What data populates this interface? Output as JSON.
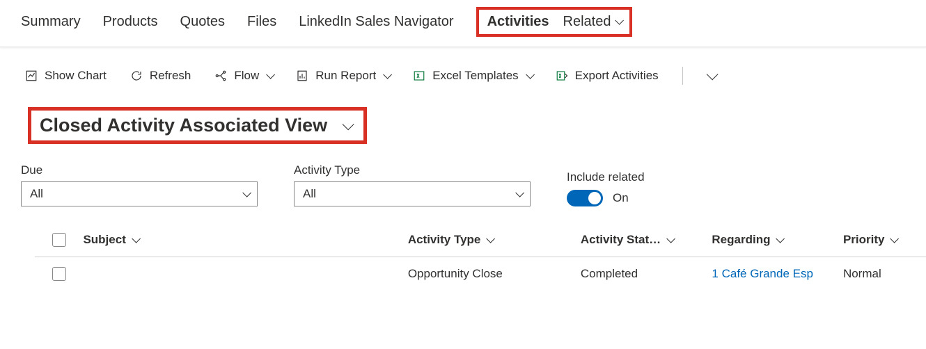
{
  "tabs": {
    "t0": "Summary",
    "t1": "Products",
    "t2": "Quotes",
    "t3": "Files",
    "t4": "LinkedIn Sales Navigator",
    "t5": "Activities",
    "t6": "Related"
  },
  "toolbar": {
    "show_chart": "Show Chart",
    "refresh": "Refresh",
    "flow": "Flow",
    "run_report": "Run Report",
    "excel_templates": "Excel Templates",
    "export_activities": "Export Activities"
  },
  "view": {
    "title": "Closed Activity Associated View"
  },
  "filters": {
    "due_label": "Due",
    "due_value": "All",
    "type_label": "Activity Type",
    "type_value": "All",
    "include_label": "Include related",
    "include_value": "On"
  },
  "columns": {
    "subject": "Subject",
    "activity_type": "Activity Type",
    "activity_status": "Activity Stat…",
    "regarding": "Regarding",
    "priority": "Priority"
  },
  "rows": [
    {
      "subject": "",
      "activity_type": "Opportunity Close",
      "activity_status": "Completed",
      "regarding": "1 Café Grande Esp",
      "priority": "Normal"
    }
  ]
}
